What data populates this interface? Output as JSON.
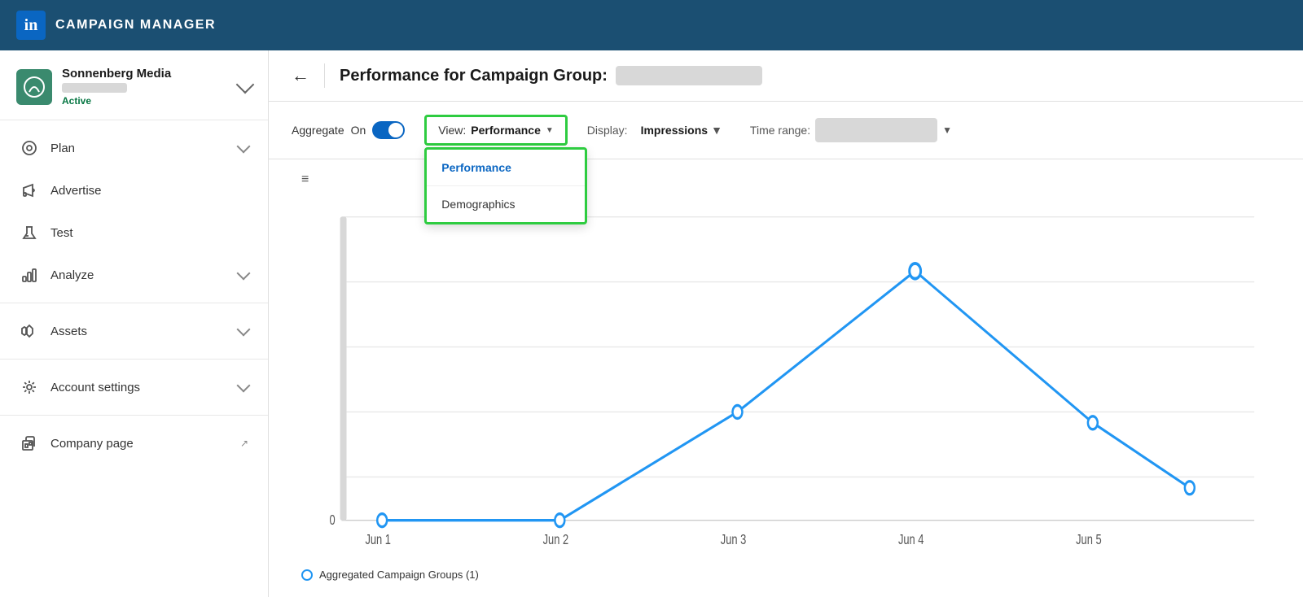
{
  "topnav": {
    "logo_letter": "in",
    "title": "CAMPAIGN MANAGER"
  },
  "sidebar": {
    "account": {
      "name": "Sonnenberg Media",
      "status": "Active"
    },
    "items": [
      {
        "id": "plan",
        "label": "Plan",
        "has_chevron": true,
        "icon": "⊙"
      },
      {
        "id": "advertise",
        "label": "Advertise",
        "has_chevron": false,
        "icon": "📢"
      },
      {
        "id": "test",
        "label": "Test",
        "has_chevron": false,
        "icon": "🧪"
      },
      {
        "id": "analyze",
        "label": "Analyze",
        "has_chevron": true,
        "icon": "📊"
      },
      {
        "id": "assets",
        "label": "Assets",
        "has_chevron": true,
        "icon": "🎨"
      },
      {
        "id": "account-settings",
        "label": "Account settings",
        "has_chevron": true,
        "icon": "⚙"
      },
      {
        "id": "company-page",
        "label": "Company page",
        "has_chevron": false,
        "icon": "🏢",
        "external": true
      }
    ]
  },
  "header": {
    "title_prefix": "Performance for Campaign Group:",
    "back_label": "←"
  },
  "toolbar": {
    "aggregate_label": "Aggregate",
    "aggregate_on": "On",
    "view_label": "View:",
    "view_value": "Performance",
    "display_label": "Display:",
    "display_value": "Impressions",
    "time_label": "Time range:"
  },
  "dropdown": {
    "items": [
      {
        "id": "performance",
        "label": "Performance",
        "active": true
      },
      {
        "id": "demographics",
        "label": "Demographics",
        "active": false
      }
    ]
  },
  "chart": {
    "legend_label": "Aggregated Campaign Groups (1)",
    "x_labels": [
      "Jun 1",
      "Jun 2",
      "Jun 3",
      "Jun 4",
      "Jun 5"
    ],
    "y_zero": "0"
  }
}
